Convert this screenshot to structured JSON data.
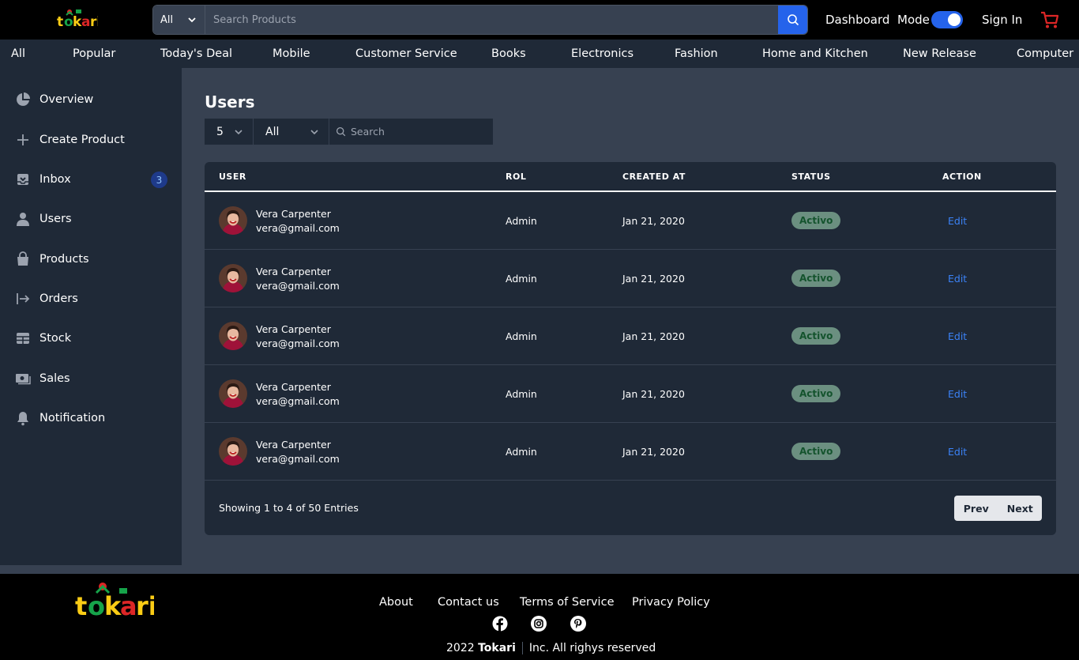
{
  "header": {
    "logo_text": "tokari",
    "search_category": "All",
    "search_placeholder": "Search Products",
    "dashboard_label": "Dashboard",
    "mode_label": "Mode",
    "mode_on": true,
    "signin_label": "Sign In"
  },
  "categories": [
    "All",
    "Popular",
    "Today's Deal",
    "Mobile",
    "Customer Service",
    "Books",
    "Electronics",
    "Fashion",
    "Home and Kitchen",
    "New Release",
    "Computer"
  ],
  "sidebar": {
    "items": [
      {
        "label": "Overview",
        "icon": "pie-chart-icon"
      },
      {
        "label": "Create Product",
        "icon": "plus-icon"
      },
      {
        "label": "Inbox",
        "icon": "inbox-icon",
        "badge": "3"
      },
      {
        "label": "Users",
        "icon": "user-icon"
      },
      {
        "label": "Products",
        "icon": "shopping-bag-icon"
      },
      {
        "label": "Orders",
        "icon": "arrow-right-to-bracket-icon"
      },
      {
        "label": "Stock",
        "icon": "table-icon"
      },
      {
        "label": "Sales",
        "icon": "cash-icon"
      },
      {
        "label": "Notification",
        "icon": "bell-icon"
      }
    ]
  },
  "main": {
    "title": "Users",
    "filters": {
      "page_size": "5",
      "role_filter": "All",
      "search_placeholder": "Search"
    },
    "table": {
      "columns": [
        "USER",
        "ROL",
        "CREATED AT",
        "STATUS",
        "ACTION"
      ],
      "rows": [
        {
          "name": "Vera Carpenter",
          "email": "vera@gmail.com",
          "role": "Admin",
          "created": "Jan 21, 2020",
          "status": "Activo",
          "action": "Edit"
        },
        {
          "name": "Vera Carpenter",
          "email": "vera@gmail.com",
          "role": "Admin",
          "created": "Jan 21, 2020",
          "status": "Activo",
          "action": "Edit"
        },
        {
          "name": "Vera Carpenter",
          "email": "vera@gmail.com",
          "role": "Admin",
          "created": "Jan 21, 2020",
          "status": "Activo",
          "action": "Edit"
        },
        {
          "name": "Vera Carpenter",
          "email": "vera@gmail.com",
          "role": "Admin",
          "created": "Jan 21, 2020",
          "status": "Activo",
          "action": "Edit"
        },
        {
          "name": "Vera Carpenter",
          "email": "vera@gmail.com",
          "role": "Admin",
          "created": "Jan 21, 2020",
          "status": "Activo",
          "action": "Edit"
        }
      ]
    },
    "showing_text": "Showing 1 to 4 of 50 Entries",
    "prev_label": "Prev",
    "next_label": "Next"
  },
  "footer": {
    "logo_text": "tokari",
    "links": [
      "About",
      "Contact us",
      "Terms of Service",
      "Privacy Policy"
    ],
    "social": [
      "facebook-icon",
      "instagram-icon",
      "pinterest-icon"
    ],
    "copyright_year": "2022",
    "copyright_brand": "Tokari",
    "copyright_rest": "Inc. All righys reserved"
  },
  "colors": {
    "accent": "#2563eb",
    "background": "#374151",
    "panel": "#1f2937",
    "status_bg": "#6b8f80",
    "link": "#3b82f6",
    "cart": "#dc2626"
  }
}
